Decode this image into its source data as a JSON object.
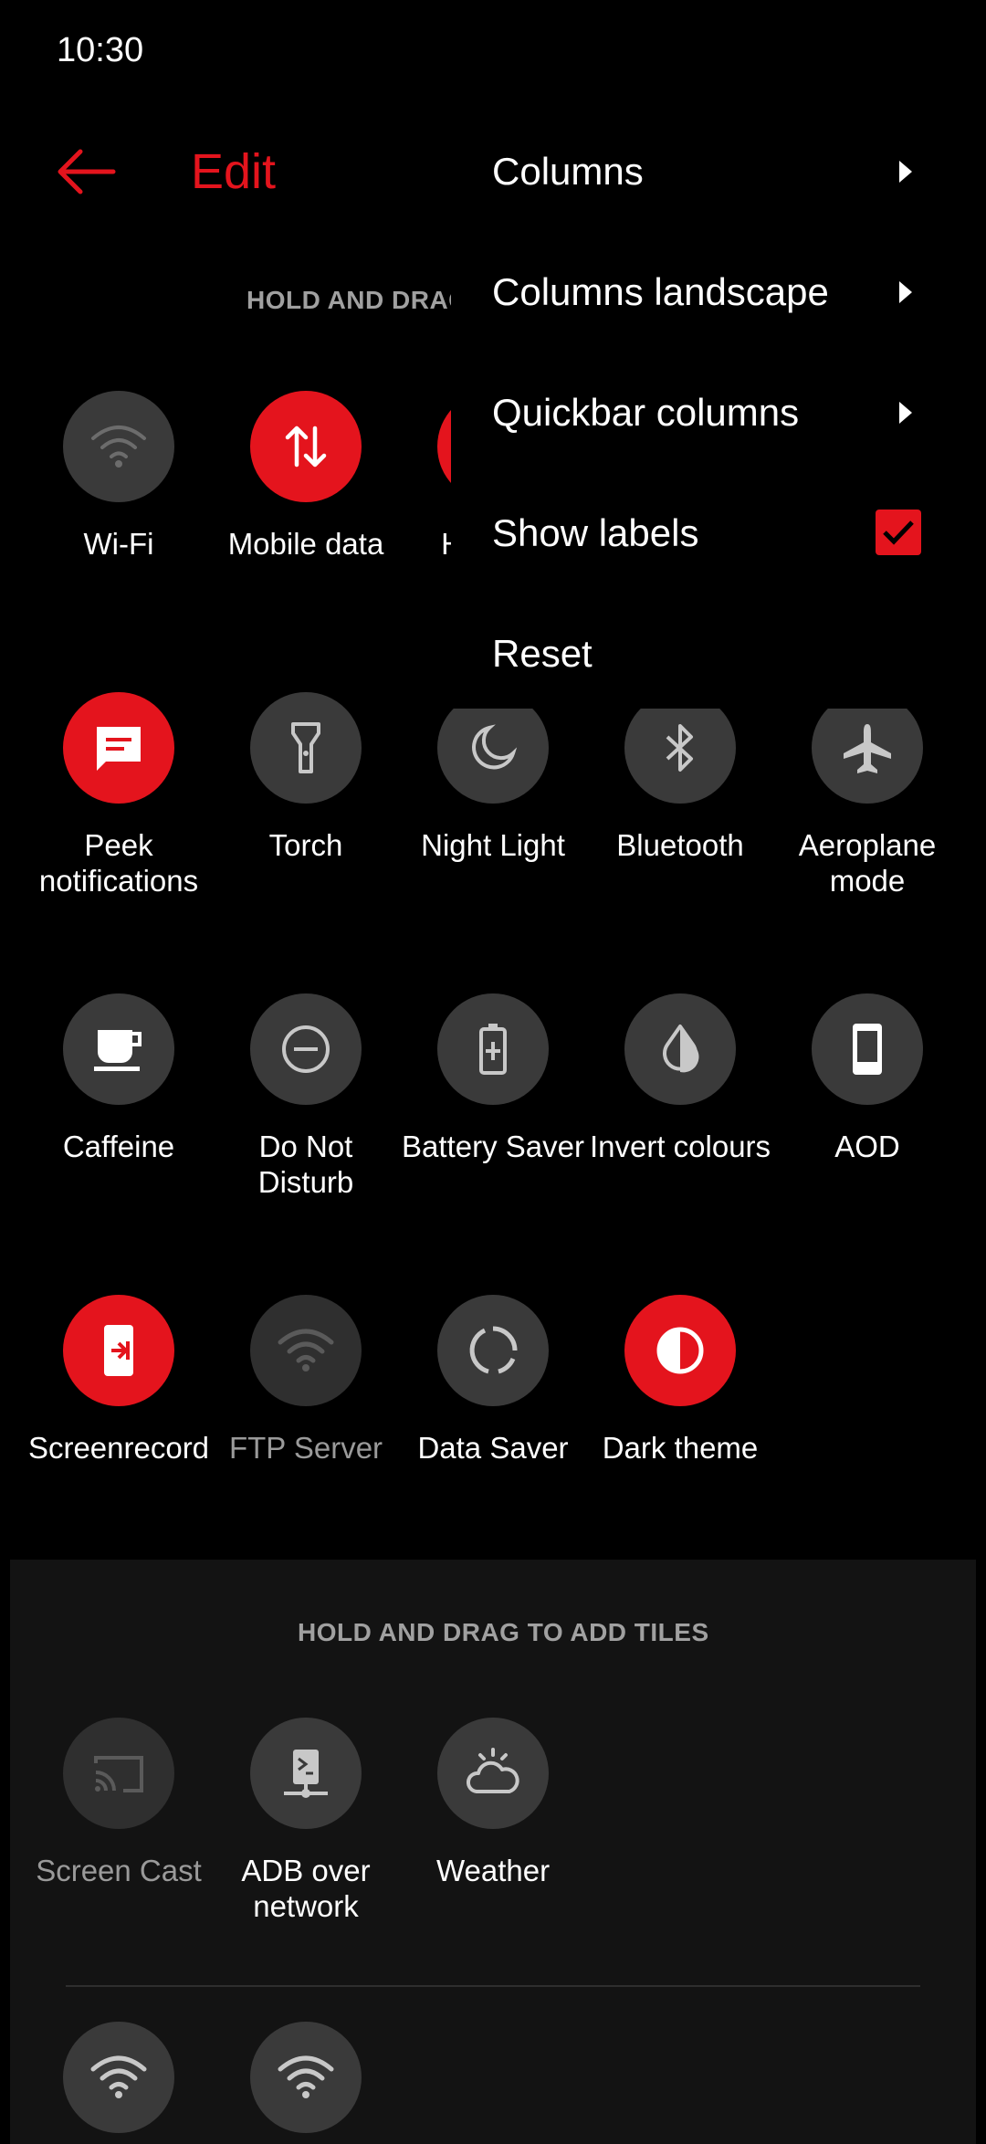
{
  "status_bar": {
    "time": "10:30"
  },
  "header": {
    "title": "Edit"
  },
  "sections": {
    "active_header": "HOLD AND DRAG TO REARRANGE TILES",
    "available_header": "HOLD AND DRAG TO ADD TILES"
  },
  "active_tiles": [
    {
      "label": "Wi-Fi",
      "icon": "wifi-icon",
      "state": "inactive"
    },
    {
      "label": "Mobile data",
      "icon": "mobile-data-icon",
      "state": "active"
    },
    {
      "label": "Hotspot",
      "icon": "hotspot-icon",
      "state": "active"
    },
    {
      "label": "Peek notifications",
      "icon": "peek-notifications-icon",
      "state": "active"
    },
    {
      "label": "Torch",
      "icon": "torch-icon",
      "state": "inactive"
    },
    {
      "label": "Night Light",
      "icon": "night-light-icon",
      "state": "inactive"
    },
    {
      "label": "Bluetooth",
      "icon": "bluetooth-icon",
      "state": "inactive"
    },
    {
      "label": "Aeroplane mode",
      "icon": "aeroplane-icon",
      "state": "inactive"
    },
    {
      "label": "Caffeine",
      "icon": "caffeine-icon",
      "state": "inactive"
    },
    {
      "label": "Do Not Disturb",
      "icon": "do-not-disturb-icon",
      "state": "inactive"
    },
    {
      "label": "Battery Saver",
      "icon": "battery-saver-icon",
      "state": "inactive"
    },
    {
      "label": "Invert colours",
      "icon": "invert-colours-icon",
      "state": "inactive"
    },
    {
      "label": "AOD",
      "icon": "aod-icon",
      "state": "inactive"
    },
    {
      "label": "Screenrecord",
      "icon": "screenrecord-icon",
      "state": "active"
    },
    {
      "label": "FTP Server",
      "icon": "ftp-server-icon",
      "state": "unavailable"
    },
    {
      "label": "Data Saver",
      "icon": "data-saver-icon",
      "state": "inactive"
    },
    {
      "label": "Dark theme",
      "icon": "dark-theme-icon",
      "state": "active"
    }
  ],
  "available_tiles": [
    {
      "label": "Screen Cast",
      "icon": "screen-cast-icon",
      "state": "unavailable"
    },
    {
      "label": "ADB over network",
      "icon": "adb-icon",
      "state": "inactive"
    },
    {
      "label": "Weather",
      "icon": "weather-icon",
      "state": "inactive"
    },
    {
      "label": "",
      "icon": "wifi-icon",
      "state": "inactive"
    },
    {
      "label": "",
      "icon": "wifi-icon",
      "state": "inactive"
    }
  ],
  "menu": {
    "columns": "Columns",
    "columns_landscape": "Columns landscape",
    "quickbar_columns": "Quickbar columns",
    "show_labels": "Show labels",
    "show_labels_checked": true,
    "reset": "Reset"
  },
  "colors": {
    "accent": "#e4141d",
    "tile_bg": "#3a3a3a",
    "background": "#000000"
  }
}
